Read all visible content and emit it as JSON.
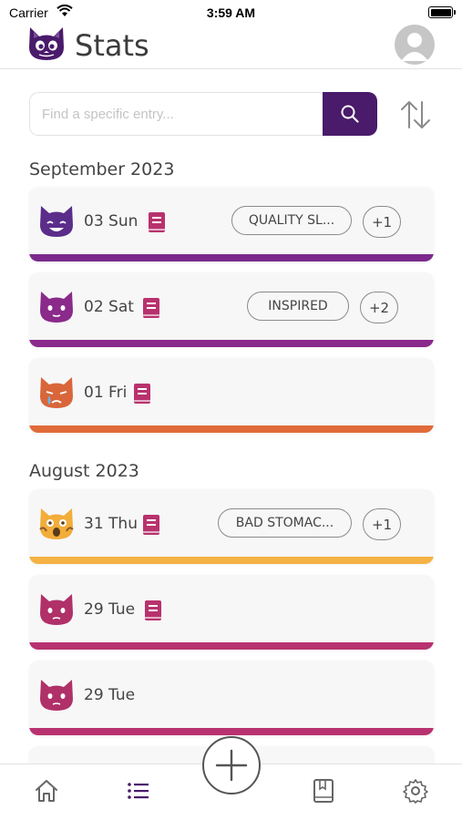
{
  "status_bar": {
    "carrier": "Carrier",
    "time": "3:59 AM"
  },
  "header": {
    "title": "Stats"
  },
  "search": {
    "placeholder": "Find a specific entry..."
  },
  "groups": [
    {
      "month": "September 2023",
      "entries": [
        {
          "date": "03 Sun",
          "mood_color": "#7b2a8c",
          "face_color": "#5a2d8a",
          "has_journal": true,
          "tag": "QUALITY SL...",
          "more": "+1"
        },
        {
          "date": "02 Sat",
          "mood_color": "#8a2a8c",
          "face_color": "#8a2a8a",
          "has_journal": true,
          "tag": "INSPIRED",
          "more": "+2"
        },
        {
          "date": "01 Fri",
          "mood_color": "#e06a3a",
          "face_color": "#d9663a",
          "has_journal": true
        }
      ]
    },
    {
      "month": "August 2023",
      "entries": [
        {
          "date": "31 Thu",
          "mood_color": "#f5b245",
          "face_color": "#f2ad3a",
          "has_journal": true,
          "tag": "BAD STOMAC...",
          "more": "+1"
        },
        {
          "date": "29 Tue",
          "mood_color": "#b83270",
          "face_color": "#b03068",
          "has_journal": true
        },
        {
          "date": "29 Tue",
          "mood_color": "#b83270",
          "face_color": "#b03068",
          "has_journal": false
        }
      ]
    }
  ],
  "colors": {
    "accent": "#4a1a6b",
    "journal": "#b8326e",
    "nav_active": "#4a1a6b"
  },
  "nav": [
    {
      "name": "home",
      "icon": "home-icon"
    },
    {
      "name": "list",
      "icon": "list-icon",
      "active": true
    },
    {
      "name": "add",
      "icon": "plus-icon"
    },
    {
      "name": "journal",
      "icon": "book-icon"
    },
    {
      "name": "settings",
      "icon": "gear-icon"
    }
  ]
}
